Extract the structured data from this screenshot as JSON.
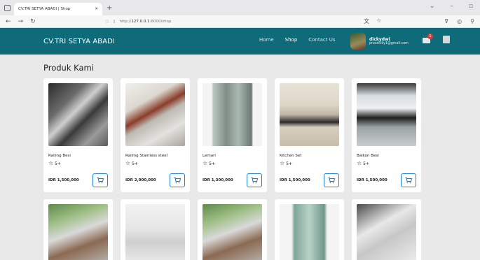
{
  "browser": {
    "tab_title": "CV.TRI SETYA ABADI | Shop",
    "url_host": "http://",
    "url_bold": "127.0.0.1",
    "url_rest": ":8000/shop"
  },
  "navbar": {
    "brand": "CV.TRI SETYA ABADI",
    "menu": [
      "Home",
      "Shop",
      "Contact Us"
    ],
    "active": "Shop",
    "user_name": "dickydwi",
    "user_email": "prasdicky1@gmail.com",
    "cart_count": "1",
    "color": "#0f6b7a"
  },
  "page": {
    "heading": "Produk Kami"
  },
  "products": [
    {
      "name": "Railing Besi",
      "rating": "5+",
      "price": "IDR 1,500,000",
      "image": "railing-besi-photo"
    },
    {
      "name": "Railing Stainless steel",
      "rating": "5+",
      "price": "IDR 2,000,000",
      "image": "railing-stainless-photo"
    },
    {
      "name": "Lemari",
      "rating": "5+",
      "price": "IDR 1,300,000",
      "image": "lemari-photo"
    },
    {
      "name": "Kitchen Set",
      "rating": "5+",
      "price": "IDR 1,500,000",
      "image": "kitchen-set-photo"
    },
    {
      "name": "Balkon Besi",
      "rating": "5+",
      "price": "IDR 1,500,000",
      "image": "balkon-besi-photo"
    }
  ],
  "icons": {
    "star": "star-outline-icon",
    "cart": "cart-icon"
  }
}
